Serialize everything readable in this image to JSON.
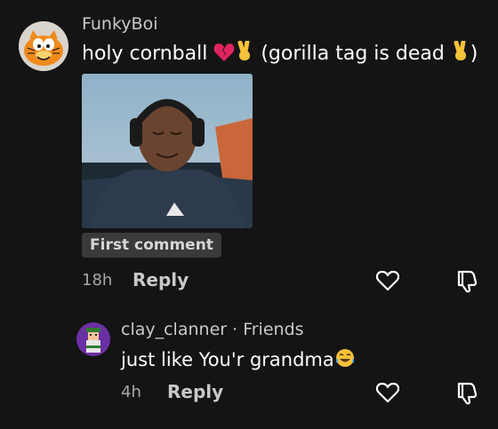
{
  "comments": [
    {
      "username": "FunkyBoi",
      "text_parts": [
        "holy cornball ",
        " (gorilla tag is dead ",
        ")"
      ],
      "badge": "First comment",
      "time": "18h",
      "reply_label": "Reply",
      "emojis": [
        "broken-heart",
        "victory-hand",
        "victory-hand"
      ]
    },
    {
      "username": "clay_clanner",
      "relation": "· Friends",
      "text": "just like You'r grandma",
      "time": "4h",
      "reply_label": "Reply",
      "emojis": [
        "tears-of-joy"
      ]
    }
  ],
  "colors": {
    "background": "#141414",
    "muted": "#a8a8a8",
    "badge_bg": "#3a3a3a"
  }
}
